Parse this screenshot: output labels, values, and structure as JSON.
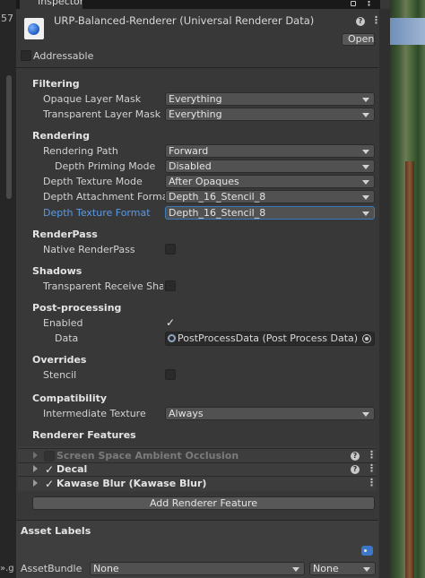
{
  "window": {
    "tab_title": "Inspector",
    "left_number": "57",
    "left_bottom_text": "».g"
  },
  "asset": {
    "title": "URP-Balanced-Renderer (Universal Renderer Data)",
    "open_label": "Open",
    "addressable_label": "Addressable"
  },
  "filtering": {
    "header": "Filtering",
    "opaque_label": "Opaque Layer Mask",
    "opaque_value": "Everything",
    "transparent_label": "Transparent Layer Mask",
    "transparent_value": "Everything"
  },
  "rendering": {
    "header": "Rendering",
    "path_label": "Rendering Path",
    "path_value": "Forward",
    "depth_priming_label": "Depth Priming Mode",
    "depth_priming_value": "Disabled",
    "depth_texture_mode_label": "Depth Texture Mode",
    "depth_texture_mode_value": "After Opaques",
    "depth_attachment_label": "Depth Attachment Format",
    "depth_attachment_value": "Depth_16_Stencil_8",
    "depth_texture_format_label": "Depth Texture Format",
    "depth_texture_format_value": "Depth_16_Stencil_8"
  },
  "renderpass": {
    "header": "RenderPass",
    "native_label": "Native RenderPass"
  },
  "shadows": {
    "header": "Shadows",
    "transparent_receive_label": "Transparent Receive Shado"
  },
  "postprocessing": {
    "header": "Post-processing",
    "enabled_label": "Enabled",
    "data_label": "Data",
    "data_value": "PostProcessData (Post Process Data)"
  },
  "overrides": {
    "header": "Overrides",
    "stencil_label": "Stencil"
  },
  "compatibility": {
    "header": "Compatibility",
    "intermediate_label": "Intermediate Texture",
    "intermediate_value": "Always"
  },
  "renderer_features": {
    "header": "Renderer Features",
    "items": [
      {
        "label": "Screen Space Ambient Occlusion"
      },
      {
        "label": "Decal"
      },
      {
        "label": "Kawase Blur (Kawase Blur)"
      }
    ],
    "add_label": "Add Renderer Feature"
  },
  "asset_labels": {
    "header": "Asset Labels",
    "bundle_label": "AssetBundle",
    "bundle_value": "None",
    "variant_value": "None"
  },
  "colors": {
    "panel": "#383838",
    "focus_label": "#5a9ae6",
    "focus_border": "#3a79bb",
    "label_icon": "#3b78c9"
  }
}
